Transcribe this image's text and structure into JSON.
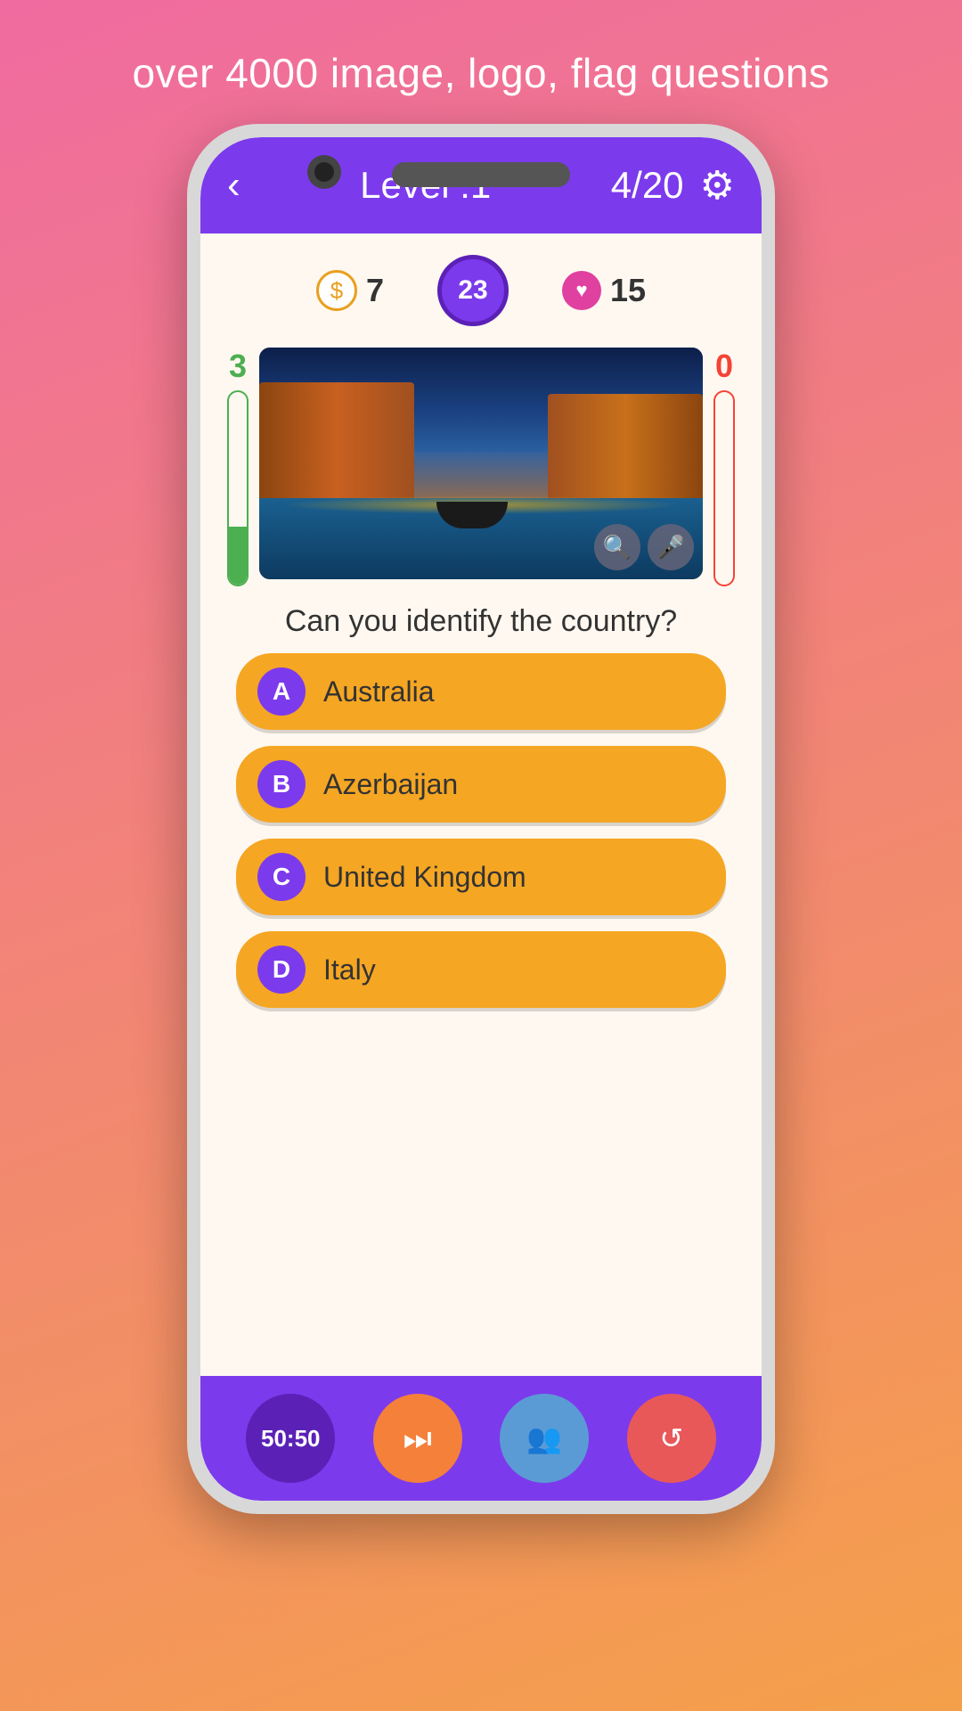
{
  "tagline": "over 4000 image, logo, flag questions",
  "header": {
    "level_label": "Level :1",
    "score": "4/20",
    "back_icon": "‹",
    "settings_icon": "⚙"
  },
  "stats": {
    "coins": "7",
    "timer": "23",
    "hearts": "15"
  },
  "bars": {
    "left_label": "3",
    "right_label": "0"
  },
  "question": "Can you identify the country?",
  "answers": [
    {
      "letter": "A",
      "text": "Australia"
    },
    {
      "letter": "B",
      "text": "Azerbaijan"
    },
    {
      "letter": "C",
      "text": "United Kingdom"
    },
    {
      "letter": "D",
      "text": "Italy"
    }
  ],
  "bottom_buttons": {
    "fifty_fifty": "50:50",
    "skip_icon": "⏭",
    "friends_icon": "👥",
    "history_icon": "↺"
  },
  "image_icons": {
    "zoom": "🔍",
    "mic": "🎤"
  }
}
